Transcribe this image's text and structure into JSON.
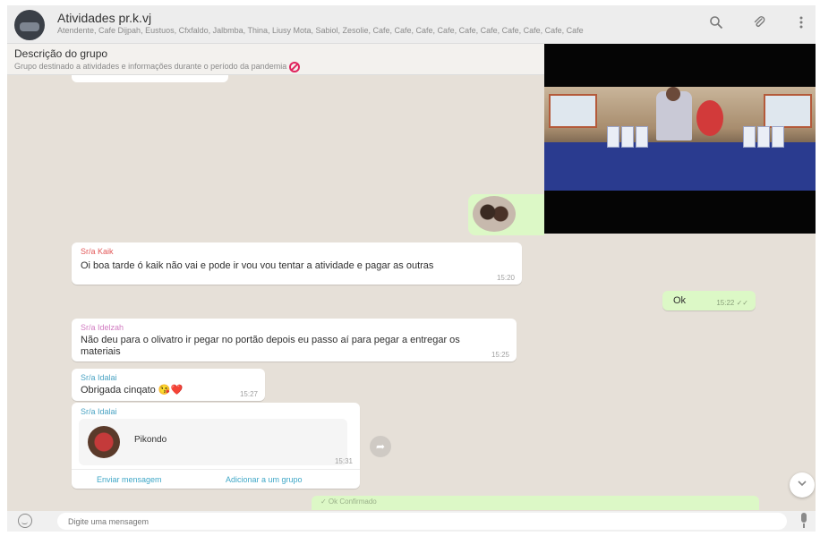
{
  "header": {
    "title": "Atividades pr.k.vj",
    "subtitle": "Atendente, Cafe Dijpah, Eustuos, Cfxfaldo, Jalbmba, Thina, Liusy Mota, Sabiol, Zesolie, Cafe, Cafe, Cafe, Cafe, Cafe, Cafe, Cafe, Cafe, Cafe, Cafe",
    "search_icon": "search-icon",
    "attach_icon": "paperclip-icon",
    "menu_icon": "kebab-menu-icon"
  },
  "description": {
    "title": "Descrição do grupo",
    "text": "Grupo destinado a atividades e informações durante o período da pandemia"
  },
  "messages": [
    {
      "sender": "Sr/a Kaik",
      "sender_color": "#e25757",
      "text": "Oi boa tarde ó kaik não vai e pode ir vou vou tentar a atividade e pagar as outras",
      "time": "15:20"
    },
    {
      "text": "Ok",
      "time": "15:22 ✓✓"
    },
    {
      "sender": "Sr/a Idelzah",
      "sender_color": "#d17ac1",
      "text": "Não deu para o olivatro ir pegar no portão depois eu passo aí para pegar a entregar os materiais",
      "time": "15:25"
    },
    {
      "sender": "Sr/a Idalai",
      "sender_color": "#4aa3c3",
      "text": "Obrigada cinqato 😘❤️",
      "time": "15:27"
    },
    {
      "sender": "Sr/a Idalai",
      "sender_color": "#4aa3c3",
      "file_name": "Pikondo",
      "time": "15:31",
      "action_message": "Enviar mensagem",
      "action_add": "Adicionar a um grupo"
    }
  ],
  "bottom_partial": "✓ Ok Confirmado",
  "composer": {
    "placeholder": "Digite uma mensagem"
  },
  "colors": {
    "incoming": "#ffffff",
    "outgoing": "#dcf8c6",
    "chat_bg": "#e6e0d8"
  }
}
